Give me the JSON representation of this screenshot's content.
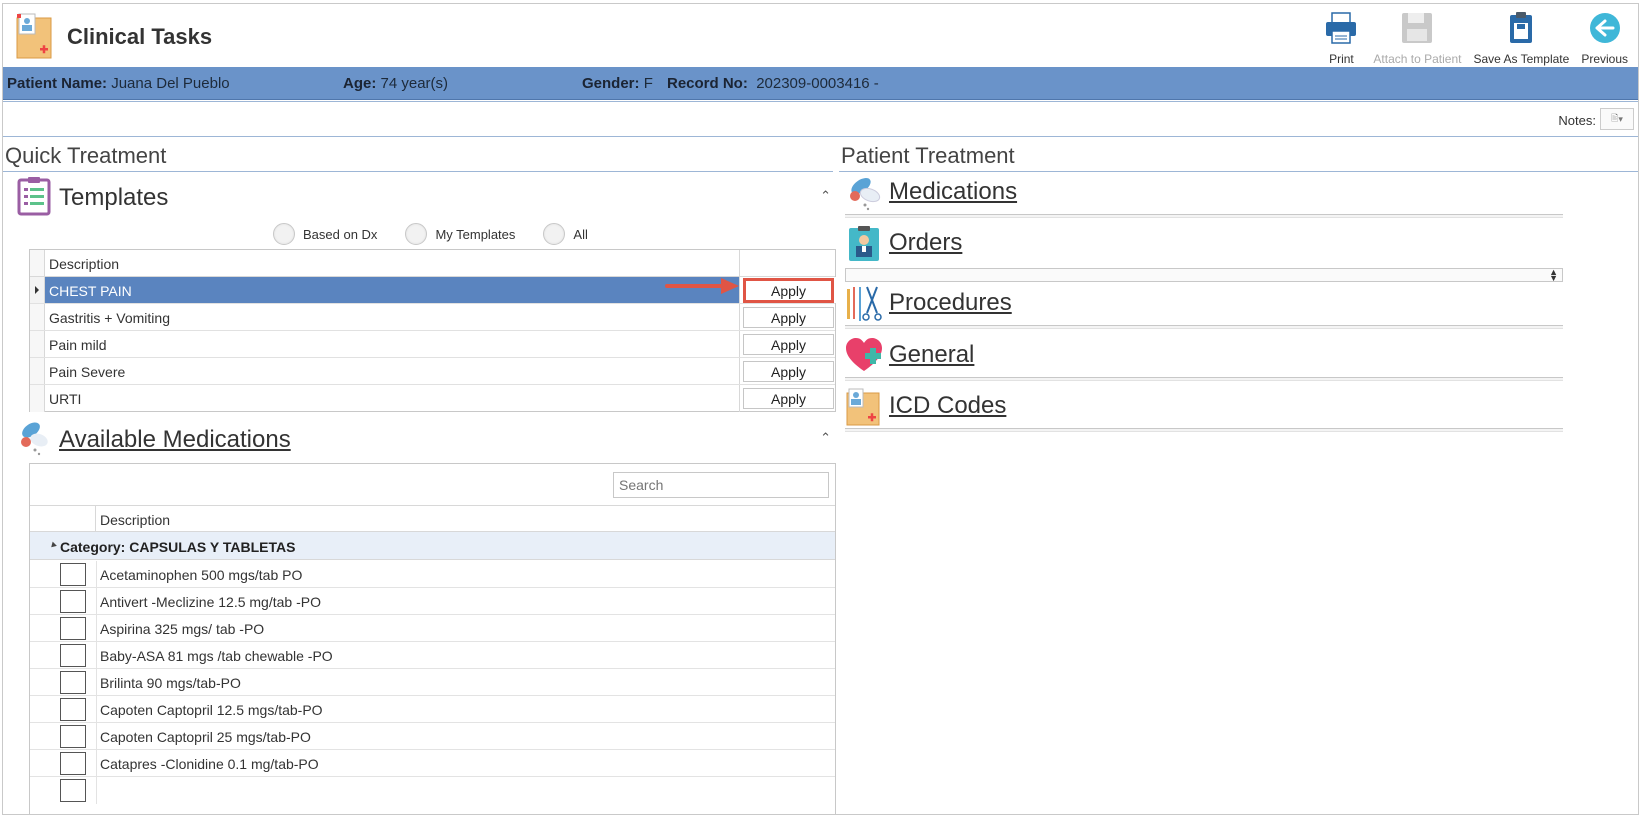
{
  "header": {
    "title": "Clinical Tasks"
  },
  "toolbar": {
    "print": "Print",
    "attach": "Attach to Patient",
    "save_template": "Save As Template",
    "previous": "Previous"
  },
  "patient": {
    "name_label": "Patient Name:",
    "name": "Juana Del Pueblo",
    "age_label": "Age:",
    "age": "74 year(s)",
    "gender_label": "Gender:",
    "gender": "F",
    "record_label": "Record No:",
    "record": "202309-0003416 -"
  },
  "notes": {
    "label": "Notes:"
  },
  "quick_treatment": {
    "title": "Quick Treatment",
    "templates": {
      "title": "Templates",
      "filters": [
        "Based on Dx",
        "My Templates",
        "All"
      ],
      "column_header": "Description",
      "apply_label": "Apply",
      "rows": [
        "CHEST PAIN",
        "Gastritis + Vomiting",
        "Pain mild",
        "Pain Severe",
        "URTI"
      ]
    },
    "medications": {
      "title": "Available Medications",
      "search_placeholder": "Search",
      "column_header": "Description",
      "category": "Category: CAPSULAS Y TABLETAS",
      "rows": [
        "Acetaminophen 500 mgs/tab PO",
        "Antivert -Meclizine 12.5 mg/tab -PO",
        "Aspirina 325 mgs/ tab -PO",
        "Baby-ASA 81 mgs /tab chewable -PO",
        "Brilinta 90 mgs/tab-PO",
        "Capoten Captopril 12.5 mgs/tab-PO",
        "Capoten Captopril 25 mgs/tab-PO",
        "Catapres -Clonidine 0.1 mg/tab-PO"
      ]
    }
  },
  "patient_treatment": {
    "title": "Patient Treatment",
    "sections": [
      "Medications",
      "Orders",
      "Procedures",
      "General",
      "ICD Codes"
    ]
  }
}
